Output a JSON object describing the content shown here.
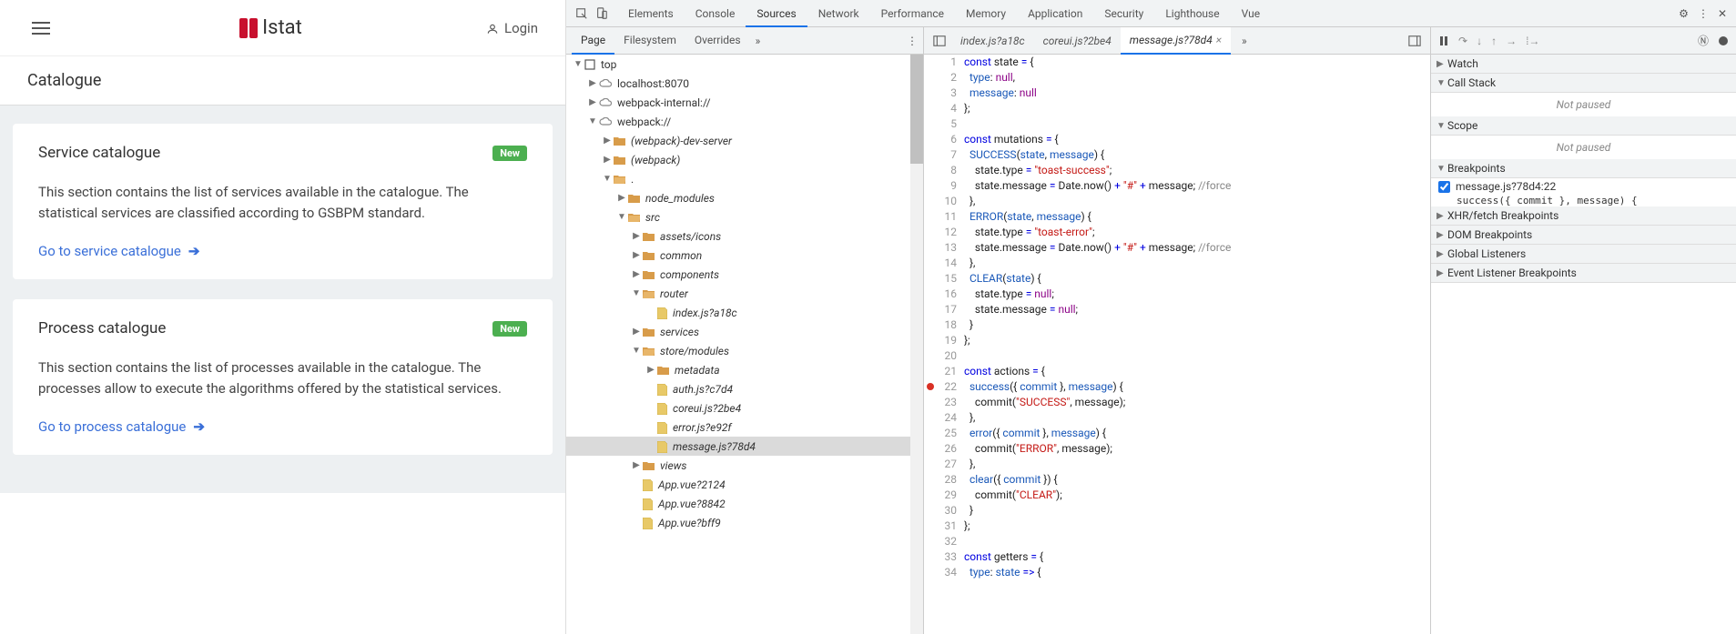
{
  "app": {
    "logo_text": "Istat",
    "login": "Login",
    "subhead": "Catalogue",
    "cards": [
      {
        "title": "Service catalogue",
        "badge": "New",
        "body": "This section contains the list of services available in the catalogue. The statistical services are classified according to GSBPM standard.",
        "link": "Go to service catalogue"
      },
      {
        "title": "Process catalogue",
        "badge": "New",
        "body": "This section contains the list of processes available in the catalogue. The processes allow to execute the algorithms offered by the statistical services.",
        "link": "Go to process catalogue"
      }
    ]
  },
  "devtools": {
    "tabs": [
      "Elements",
      "Console",
      "Sources",
      "Network",
      "Performance",
      "Memory",
      "Application",
      "Security",
      "Lighthouse",
      "Vue"
    ],
    "active_tab": "Sources",
    "sub_tabs": [
      "Page",
      "Filesystem",
      "Overrides"
    ],
    "active_sub_tab": "Page",
    "file_tree": [
      {
        "d": 0,
        "exp": "open",
        "icon": "frame",
        "label": "top"
      },
      {
        "d": 1,
        "exp": "closed",
        "icon": "cloud",
        "label": "localhost:8070"
      },
      {
        "d": 1,
        "exp": "closed",
        "icon": "cloud",
        "label": "webpack-internal://"
      },
      {
        "d": 1,
        "exp": "open",
        "icon": "cloud",
        "label": "webpack://"
      },
      {
        "d": 2,
        "exp": "closed",
        "icon": "folder",
        "label": "(webpack)-dev-server",
        "italic": true
      },
      {
        "d": 2,
        "exp": "closed",
        "icon": "folder",
        "label": "(webpack)",
        "italic": true
      },
      {
        "d": 2,
        "exp": "open",
        "icon": "folder-open",
        "label": "."
      },
      {
        "d": 3,
        "exp": "closed",
        "icon": "folder",
        "label": "node_modules",
        "italic": true
      },
      {
        "d": 3,
        "exp": "open",
        "icon": "folder-open",
        "label": "src",
        "italic": true
      },
      {
        "d": 4,
        "exp": "closed",
        "icon": "folder",
        "label": "assets/icons",
        "italic": true
      },
      {
        "d": 4,
        "exp": "closed",
        "icon": "folder",
        "label": "common",
        "italic": true
      },
      {
        "d": 4,
        "exp": "closed",
        "icon": "folder",
        "label": "components",
        "italic": true
      },
      {
        "d": 4,
        "exp": "open",
        "icon": "folder-open",
        "label": "router",
        "italic": true
      },
      {
        "d": 5,
        "exp": "none",
        "icon": "file",
        "label": "index.js?a18c",
        "italic": true
      },
      {
        "d": 4,
        "exp": "closed",
        "icon": "folder",
        "label": "services",
        "italic": true
      },
      {
        "d": 4,
        "exp": "open",
        "icon": "folder-open",
        "label": "store/modules",
        "italic": true
      },
      {
        "d": 5,
        "exp": "closed",
        "icon": "folder",
        "label": "metadata",
        "italic": true
      },
      {
        "d": 5,
        "exp": "none",
        "icon": "file",
        "label": "auth.js?c7d4",
        "italic": true
      },
      {
        "d": 5,
        "exp": "none",
        "icon": "file",
        "label": "coreui.js?2be4",
        "italic": true
      },
      {
        "d": 5,
        "exp": "none",
        "icon": "file",
        "label": "error.js?e92f",
        "italic": true
      },
      {
        "d": 5,
        "exp": "none",
        "icon": "file",
        "label": "message.js?78d4",
        "italic": true,
        "selected": true
      },
      {
        "d": 4,
        "exp": "closed",
        "icon": "folder",
        "label": "views",
        "italic": true
      },
      {
        "d": 4,
        "exp": "none",
        "icon": "file",
        "label": "App.vue?2124",
        "italic": true
      },
      {
        "d": 4,
        "exp": "none",
        "icon": "file",
        "label": "App.vue?8842",
        "italic": true
      },
      {
        "d": 4,
        "exp": "none",
        "icon": "file",
        "label": "App.vue?bff9",
        "italic": true
      }
    ],
    "editor_tabs": [
      "index.js?a18c",
      "coreui.js?2be4",
      "message.js?78d4"
    ],
    "active_editor_tab": "message.js?78d4",
    "code_lines": [
      {
        "n": 1,
        "tokens": [
          [
            "k-keyword",
            "const"
          ],
          [
            "",
            " state "
          ],
          [
            "k-keyword",
            "="
          ],
          [
            "",
            " {"
          ]
        ]
      },
      {
        "n": 2,
        "tokens": [
          [
            "",
            "  "
          ],
          [
            "k-prop",
            "type"
          ],
          [
            "",
            ": "
          ],
          [
            "k-null",
            "null"
          ],
          [
            "",
            ","
          ]
        ]
      },
      {
        "n": 3,
        "tokens": [
          [
            "",
            "  "
          ],
          [
            "k-prop",
            "message"
          ],
          [
            "",
            ": "
          ],
          [
            "k-null",
            "null"
          ]
        ]
      },
      {
        "n": 4,
        "tokens": [
          [
            "",
            "};"
          ]
        ]
      },
      {
        "n": 5,
        "tokens": [
          [
            "",
            ""
          ]
        ]
      },
      {
        "n": 6,
        "tokens": [
          [
            "k-keyword",
            "const"
          ],
          [
            "",
            " mutations "
          ],
          [
            "k-keyword",
            "="
          ],
          [
            "",
            " {"
          ]
        ]
      },
      {
        "n": 7,
        "tokens": [
          [
            "",
            "  "
          ],
          [
            "k-prop",
            "SUCCESS"
          ],
          [
            "",
            "("
          ],
          [
            "k-prop",
            "state"
          ],
          [
            "",
            ", "
          ],
          [
            "k-prop",
            "message"
          ],
          [
            "",
            ") {"
          ]
        ]
      },
      {
        "n": 8,
        "tokens": [
          [
            "",
            "    state.type "
          ],
          [
            "k-keyword",
            "="
          ],
          [
            "",
            " "
          ],
          [
            "k-string",
            "\"toast-success\""
          ],
          [
            "",
            ";"
          ]
        ]
      },
      {
        "n": 9,
        "tokens": [
          [
            "",
            "    state.message "
          ],
          [
            "k-keyword",
            "="
          ],
          [
            "",
            " Date.now() "
          ],
          [
            "k-keyword",
            "+"
          ],
          [
            "",
            " "
          ],
          [
            "k-string",
            "\"#\""
          ],
          [
            "",
            " "
          ],
          [
            "k-keyword",
            "+"
          ],
          [
            "",
            " message; "
          ],
          [
            "k-comment",
            "//force"
          ]
        ]
      },
      {
        "n": 10,
        "tokens": [
          [
            "",
            "  },"
          ]
        ]
      },
      {
        "n": 11,
        "tokens": [
          [
            "",
            "  "
          ],
          [
            "k-prop",
            "ERROR"
          ],
          [
            "",
            "("
          ],
          [
            "k-prop",
            "state"
          ],
          [
            "",
            ", "
          ],
          [
            "k-prop",
            "message"
          ],
          [
            "",
            ") {"
          ]
        ]
      },
      {
        "n": 12,
        "tokens": [
          [
            "",
            "    state.type "
          ],
          [
            "k-keyword",
            "="
          ],
          [
            "",
            " "
          ],
          [
            "k-string",
            "\"toast-error\""
          ],
          [
            "",
            ";"
          ]
        ]
      },
      {
        "n": 13,
        "tokens": [
          [
            "",
            "    state.message "
          ],
          [
            "k-keyword",
            "="
          ],
          [
            "",
            " Date.now() "
          ],
          [
            "k-keyword",
            "+"
          ],
          [
            "",
            " "
          ],
          [
            "k-string",
            "\"#\""
          ],
          [
            "",
            " "
          ],
          [
            "k-keyword",
            "+"
          ],
          [
            "",
            " message; "
          ],
          [
            "k-comment",
            "//force"
          ]
        ]
      },
      {
        "n": 14,
        "tokens": [
          [
            "",
            "  },"
          ]
        ]
      },
      {
        "n": 15,
        "tokens": [
          [
            "",
            "  "
          ],
          [
            "k-prop",
            "CLEAR"
          ],
          [
            "",
            "("
          ],
          [
            "k-prop",
            "state"
          ],
          [
            "",
            ") {"
          ]
        ]
      },
      {
        "n": 16,
        "tokens": [
          [
            "",
            "    state.type "
          ],
          [
            "k-keyword",
            "="
          ],
          [
            "",
            " "
          ],
          [
            "k-null",
            "null"
          ],
          [
            "",
            ";"
          ]
        ]
      },
      {
        "n": 17,
        "tokens": [
          [
            "",
            "    state.message "
          ],
          [
            "k-keyword",
            "="
          ],
          [
            "",
            " "
          ],
          [
            "k-null",
            "null"
          ],
          [
            "",
            ";"
          ]
        ]
      },
      {
        "n": 18,
        "tokens": [
          [
            "",
            "  }"
          ]
        ]
      },
      {
        "n": 19,
        "tokens": [
          [
            "",
            "};"
          ]
        ]
      },
      {
        "n": 20,
        "tokens": [
          [
            "",
            ""
          ]
        ]
      },
      {
        "n": 21,
        "tokens": [
          [
            "k-keyword",
            "const"
          ],
          [
            "",
            " actions "
          ],
          [
            "k-keyword",
            "="
          ],
          [
            "",
            " {"
          ]
        ]
      },
      {
        "n": 22,
        "bp": true,
        "tokens": [
          [
            "",
            "  "
          ],
          [
            "k-prop",
            "success"
          ],
          [
            "",
            "({ "
          ],
          [
            "k-prop",
            "commit"
          ],
          [
            "",
            " }, "
          ],
          [
            "k-prop",
            "message"
          ],
          [
            "",
            ") {"
          ]
        ]
      },
      {
        "n": 23,
        "tokens": [
          [
            "",
            "    commit("
          ],
          [
            "k-string",
            "\"SUCCESS\""
          ],
          [
            "",
            ", message);"
          ]
        ]
      },
      {
        "n": 24,
        "tokens": [
          [
            "",
            "  },"
          ]
        ]
      },
      {
        "n": 25,
        "tokens": [
          [
            "",
            "  "
          ],
          [
            "k-prop",
            "error"
          ],
          [
            "",
            "({ "
          ],
          [
            "k-prop",
            "commit"
          ],
          [
            "",
            " }, "
          ],
          [
            "k-prop",
            "message"
          ],
          [
            "",
            ") {"
          ]
        ]
      },
      {
        "n": 26,
        "tokens": [
          [
            "",
            "    commit("
          ],
          [
            "k-string",
            "\"ERROR\""
          ],
          [
            "",
            ", message);"
          ]
        ]
      },
      {
        "n": 27,
        "tokens": [
          [
            "",
            "  },"
          ]
        ]
      },
      {
        "n": 28,
        "tokens": [
          [
            "",
            "  "
          ],
          [
            "k-prop",
            "clear"
          ],
          [
            "",
            "({ "
          ],
          [
            "k-prop",
            "commit"
          ],
          [
            "",
            " }) {"
          ]
        ]
      },
      {
        "n": 29,
        "tokens": [
          [
            "",
            "    commit("
          ],
          [
            "k-string",
            "\"CLEAR\""
          ],
          [
            "",
            ");"
          ]
        ]
      },
      {
        "n": 30,
        "tokens": [
          [
            "",
            "  }"
          ]
        ]
      },
      {
        "n": 31,
        "tokens": [
          [
            "",
            "};"
          ]
        ]
      },
      {
        "n": 32,
        "tokens": [
          [
            "",
            ""
          ]
        ]
      },
      {
        "n": 33,
        "tokens": [
          [
            "k-keyword",
            "const"
          ],
          [
            "",
            " getters "
          ],
          [
            "k-keyword",
            "="
          ],
          [
            "",
            " {"
          ]
        ]
      },
      {
        "n": 34,
        "tokens": [
          [
            "",
            "  "
          ],
          [
            "k-prop",
            "type"
          ],
          [
            "",
            ": "
          ],
          [
            "k-prop",
            "state"
          ],
          [
            "",
            " "
          ],
          [
            "k-keyword",
            "=>"
          ],
          [
            "",
            " {"
          ]
        ]
      }
    ],
    "debugger": {
      "sections": {
        "watch": {
          "label": "Watch",
          "open": false
        },
        "call_stack": {
          "label": "Call Stack",
          "open": true,
          "notice": "Not paused"
        },
        "scope": {
          "label": "Scope",
          "open": true,
          "notice": "Not paused"
        },
        "breakpoints": {
          "label": "Breakpoints",
          "open": true,
          "items": [
            {
              "checked": true,
              "label": "message.js?78d4:22",
              "sub": "success({ commit }, message) {"
            }
          ]
        },
        "xhr": {
          "label": "XHR/fetch Breakpoints",
          "open": false
        },
        "dom": {
          "label": "DOM Breakpoints",
          "open": false
        },
        "global": {
          "label": "Global Listeners",
          "open": false
        },
        "event": {
          "label": "Event Listener Breakpoints",
          "open": false
        }
      }
    }
  }
}
